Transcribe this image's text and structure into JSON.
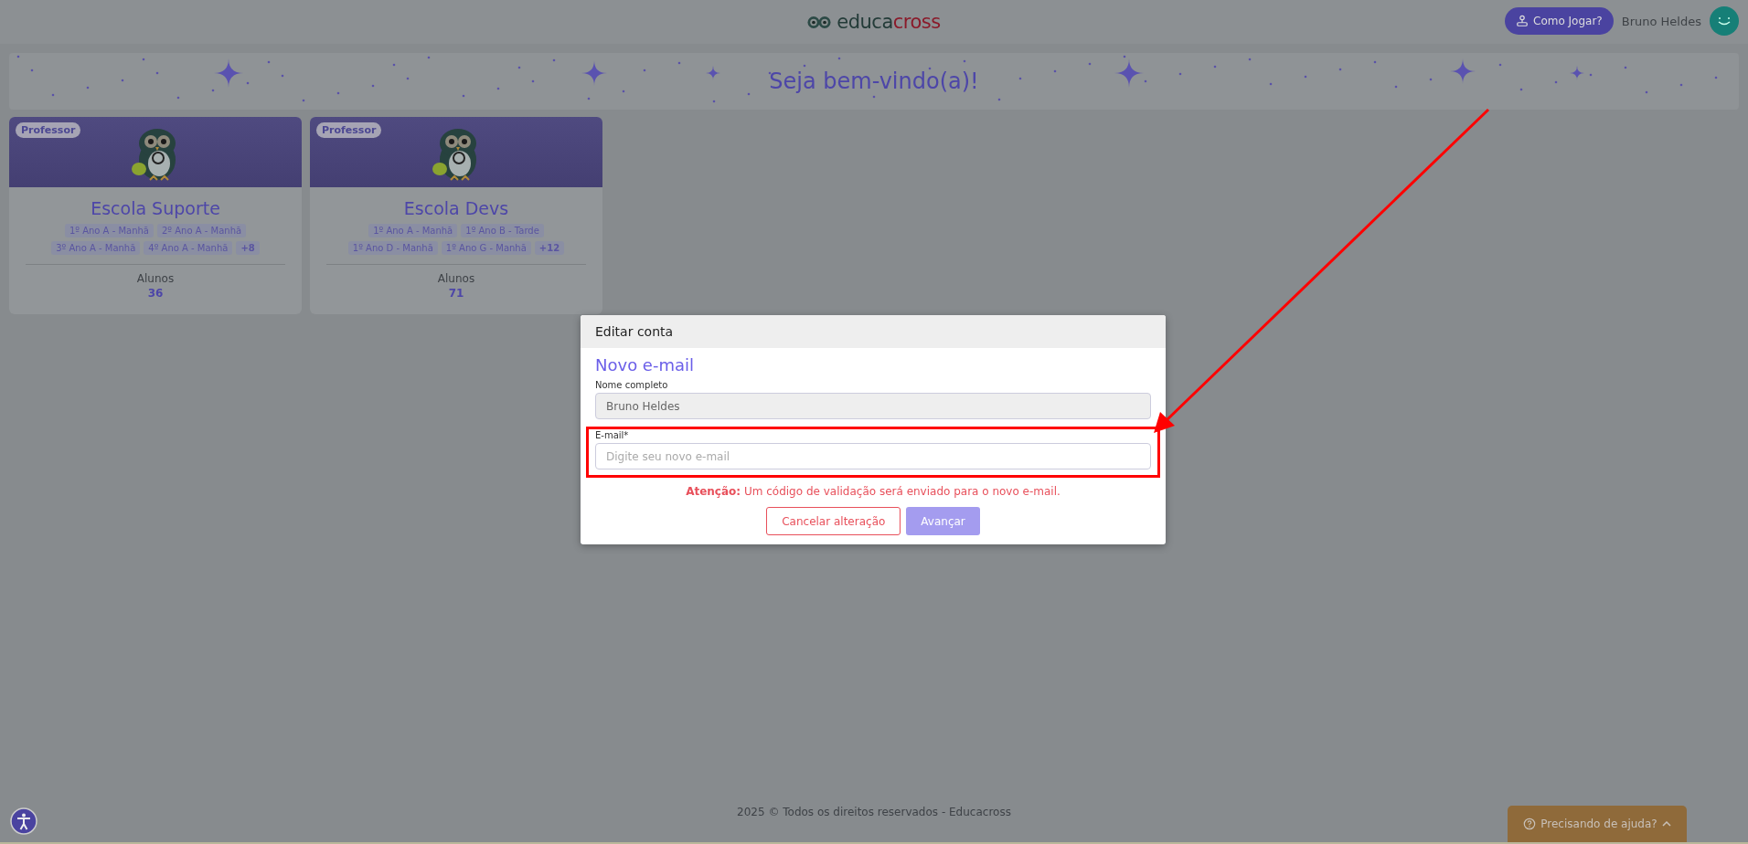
{
  "header": {
    "logo": {
      "part_1": "educa",
      "part_2": "cross"
    },
    "how_to_play_button": "Como Jogar?",
    "user_name": "Bruno Heldes"
  },
  "banner": {
    "title": "Seja bem-vindo(a)!"
  },
  "cards": [
    {
      "badge": "Professor",
      "school": "Escola Suporte",
      "classes": [
        "1º Ano A - Manhã",
        "2º Ano A - Manhã",
        "3º Ano A - Manhã",
        "4º Ano A - Manhã"
      ],
      "more": "+8",
      "students_label": "Alunos",
      "students": "36"
    },
    {
      "badge": "Professor",
      "school": "Escola Devs",
      "classes": [
        "1º Ano A - Manhã",
        "1º Ano B - Tarde",
        "1º Ano D - Manhã",
        "1º Ano G - Manhã"
      ],
      "more": "+12",
      "students_label": "Alunos",
      "students": "71"
    }
  ],
  "modal": {
    "header": "Editar conta",
    "title": "Novo e-mail",
    "fields": [
      {
        "label": "Nome completo",
        "value": "Bruno Heldes",
        "disabled": true,
        "highlighted": false
      },
      {
        "label": "E-mail*",
        "placeholder": "Digite seu novo e-mail",
        "disabled": false,
        "highlighted": true
      }
    ],
    "warning": "**Atenção:** Um código de validação será enviado para o novo e-mail.",
    "buttons": [
      {
        "label": "Cancelar alteração",
        "kind": "outline",
        "disabled": false
      },
      {
        "label": "Avançar",
        "kind": "primary",
        "disabled": true
      }
    ]
  },
  "footer": {
    "text": "2025 © Todos os direitos reservados - Educacross"
  },
  "help_button": "Precisando de ajuda?"
}
